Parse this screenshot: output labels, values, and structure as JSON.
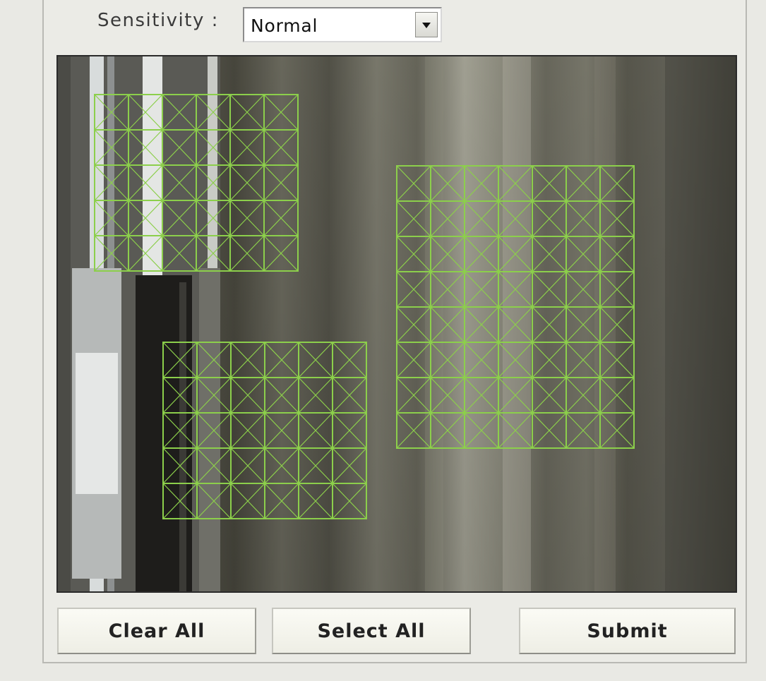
{
  "sensitivity": {
    "label": "Sensitivity :",
    "selected": "Normal"
  },
  "camera": {
    "grid_color": "#8ccf4b",
    "selected_grid_cells": [
      {
        "cols": 6,
        "rows": 5
      },
      {
        "cols": 6,
        "rows": 5
      },
      {
        "cols": 7,
        "rows": 8
      }
    ]
  },
  "buttons": {
    "clear_all": "Clear All",
    "select_all": "Select All",
    "submit": "Submit"
  }
}
